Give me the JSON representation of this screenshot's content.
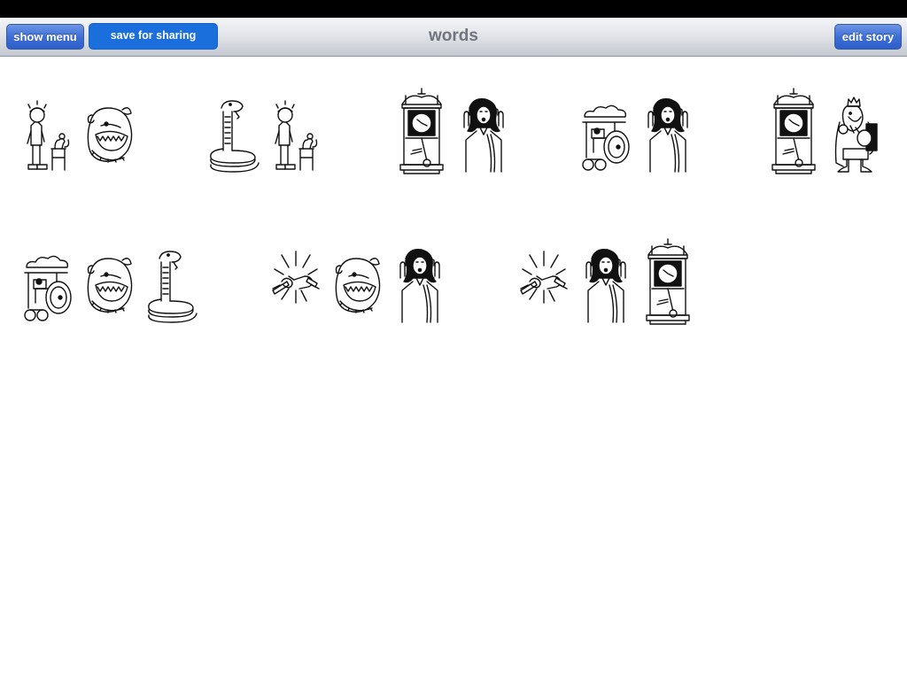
{
  "toolbar": {
    "title": "words",
    "show_menu_label": "show menu",
    "save_label": "save for sharing",
    "edit_story_label": "edit story"
  },
  "colors": {
    "nav_button": "#3e6fd6",
    "save_button": "#1a6fdc",
    "title_text": "#6f747d"
  },
  "stories": [
    {
      "pictures": [
        "scared-boy-mouse",
        "bulldog"
      ]
    },
    {
      "pictures": [
        "snake",
        "scared-boy-mouse"
      ]
    },
    {
      "pictures": [
        "grandfather-clock",
        "scared-woman"
      ]
    },
    {
      "pictures": [
        "steam-tractor",
        "scared-woman"
      ]
    },
    {
      "pictures": [
        "grandfather-clock",
        "king"
      ]
    },
    {
      "pictures": [
        "steam-tractor",
        "bulldog",
        "snake"
      ]
    },
    {
      "pictures": [
        "snapping-stick",
        "bulldog",
        "scared-woman"
      ]
    },
    {
      "pictures": [
        "snapping-stick",
        "scared-woman",
        "grandfather-clock"
      ]
    }
  ]
}
